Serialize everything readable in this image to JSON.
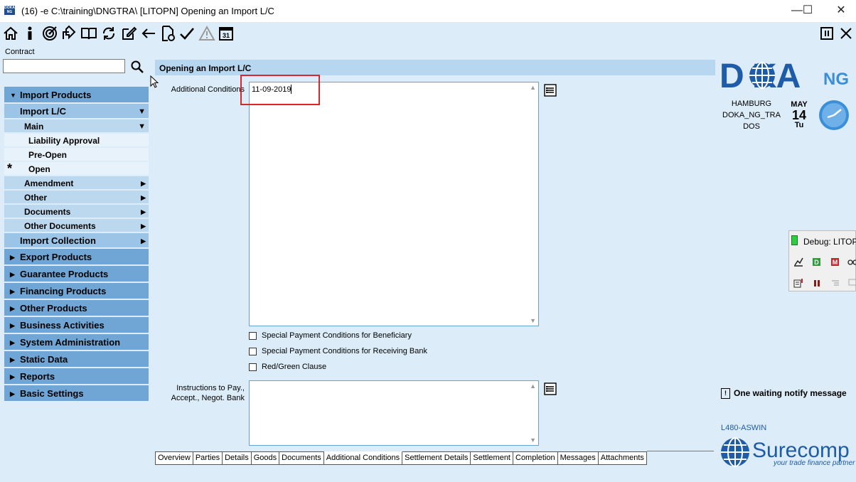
{
  "window": {
    "app_icon_text": "DOKA NG",
    "title": "(16) -e C:\\training\\DNGTRA\\  [LITOPN] Opening an Import L/C"
  },
  "toolbar": {
    "icons": [
      "home-icon",
      "info-icon",
      "target-icon",
      "export-icon",
      "book-icon",
      "refresh-icon",
      "edit-icon",
      "back-arrow-icon",
      "document-check-icon",
      "checkmark-icon",
      "warning-icon",
      "calendar-icon"
    ],
    "calendar_day": "31",
    "right_icons": [
      "pause-icon",
      "close-icon"
    ]
  },
  "contract": {
    "label": "Contract",
    "value": ""
  },
  "nav": {
    "import_products": "Import Products",
    "import_lc": "Import L/C",
    "main": "Main",
    "liability_approval": "Liability Approval",
    "pre_open": "Pre-Open",
    "open_marker": "*",
    "open": "Open",
    "amendment": "Amendment",
    "other": "Other",
    "documents": "Documents",
    "other_documents": "Other Documents",
    "import_collection": "Import Collection",
    "export_products": "Export Products",
    "guarantee_products": "Guarantee Products",
    "financing_products": "Financing Products",
    "other_products": "Other Products",
    "business_activities": "Business Activities",
    "system_administration": "System Administration",
    "static_data": "Static Data",
    "reports": "Reports",
    "basic_settings": "Basic Settings"
  },
  "form": {
    "header": "Opening an Import L/C",
    "additional_conditions_label": "Additional Conditions",
    "additional_conditions_value": "11-09-2019",
    "checkboxes": {
      "special_beneficiary": "Special Payment Conditions for Beneficiary",
      "special_receiving_bank": "Special Payment Conditions for Receiving Bank",
      "red_green_clause": "Red/Green Clause"
    },
    "instructions_label_1": "Instructions to Pay.,",
    "instructions_label_2": "Accept., Negot. Bank",
    "instructions_value": ""
  },
  "tabs": [
    "Overview",
    "Parties",
    "Details",
    "Goods",
    "Documents",
    "Additional Conditions",
    "Settlement Details",
    "Settlement",
    "Completion",
    "Messages",
    "Attachments"
  ],
  "branding": {
    "logo_main": "D  KA",
    "logo_suffix": "NG",
    "location": "HAMBURG",
    "system": "DOKA_NG_TRA",
    "mode": "DOS",
    "month": "MAY",
    "day": "14",
    "weekday": "Tu",
    "notify": "One waiting notify message",
    "user_id": "L480-ASWIN",
    "surecomp_name": "Surecomp",
    "surecomp_tagline": "your trade finance partner"
  },
  "debug": {
    "title": "Debug: LITOPN"
  },
  "colors": {
    "background": "#dcecf8",
    "nav_dark": "#6fa6d6",
    "nav_mid": "#9cc4e6",
    "brand_blue": "#1e5ba8",
    "highlight": "#d9252b"
  }
}
